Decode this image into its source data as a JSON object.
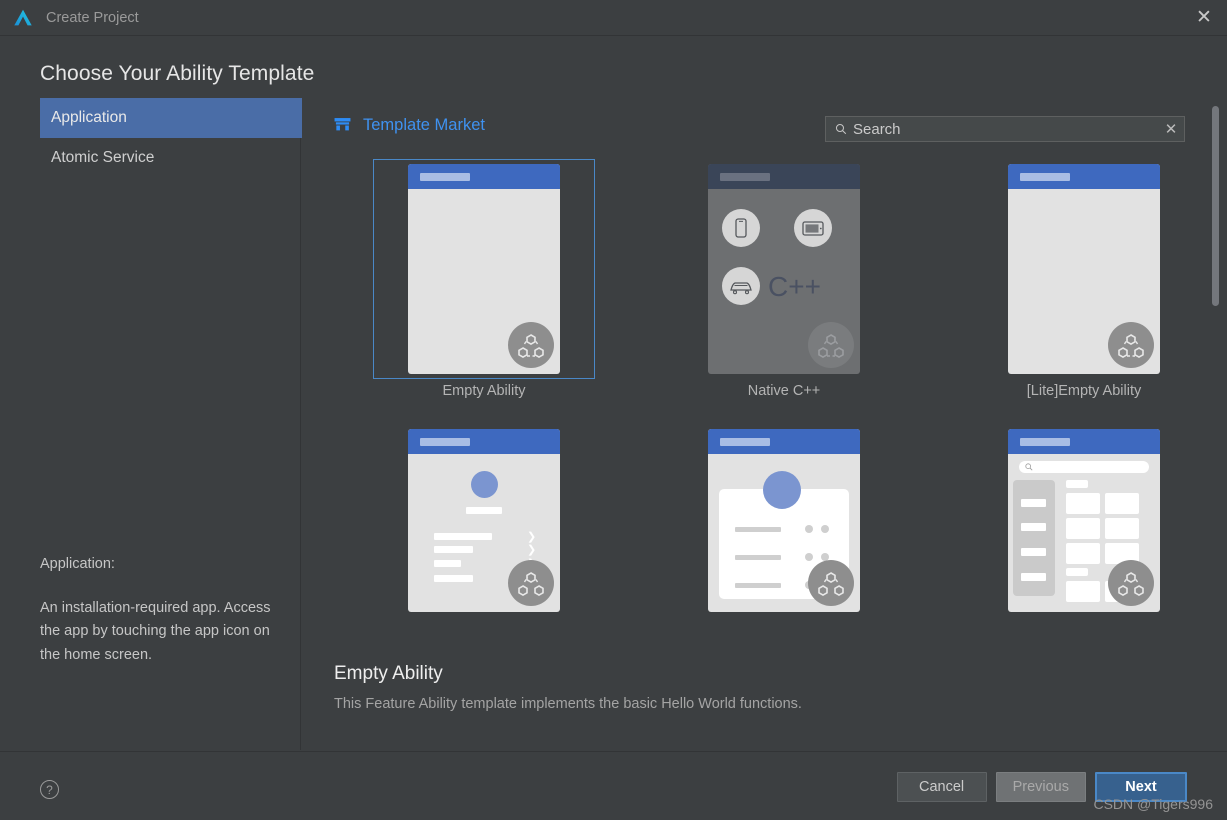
{
  "window": {
    "title": "Create Project",
    "logo_icon": "deveco-logo-icon",
    "close_icon": "✕"
  },
  "page_title": "Choose Your Ability Template",
  "sidebar": {
    "items": [
      {
        "label": "Application",
        "selected": true
      },
      {
        "label": "Atomic Service",
        "selected": false
      }
    ],
    "description_heading": "Application:",
    "description_body": "An installation-required app. Access the app by touching the app icon on the home screen."
  },
  "market": {
    "label": "Template Market",
    "icon": "store-icon"
  },
  "search": {
    "placeholder": "Search",
    "value": "",
    "icon": "search-icon",
    "clear_icon": "✕"
  },
  "templates": [
    {
      "label": "Empty Ability",
      "kind": "blank",
      "selected": true
    },
    {
      "label": "Native C++",
      "kind": "nativecpp",
      "selected": false
    },
    {
      "label": "[Lite]Empty Ability",
      "kind": "blank",
      "selected": false
    },
    {
      "label": "",
      "kind": "list",
      "selected": false
    },
    {
      "label": "",
      "kind": "card",
      "selected": false
    },
    {
      "label": "",
      "kind": "grid",
      "selected": false
    }
  ],
  "cpp_label": "C++",
  "selected_template": {
    "name": "Empty Ability",
    "description": "This Feature Ability template implements the basic Hello World functions."
  },
  "footer": {
    "help_icon": "?",
    "help_glyph": "?",
    "cancel_label": "Cancel",
    "previous_label": "Previous",
    "next_label": "Next"
  },
  "watermark": "CSDN @Tigers996",
  "colors": {
    "accent_blue": "#3f92f0",
    "selection_blue": "#4a6da7",
    "primary_button": "#37618e",
    "window_bg": "#3c3f41"
  }
}
